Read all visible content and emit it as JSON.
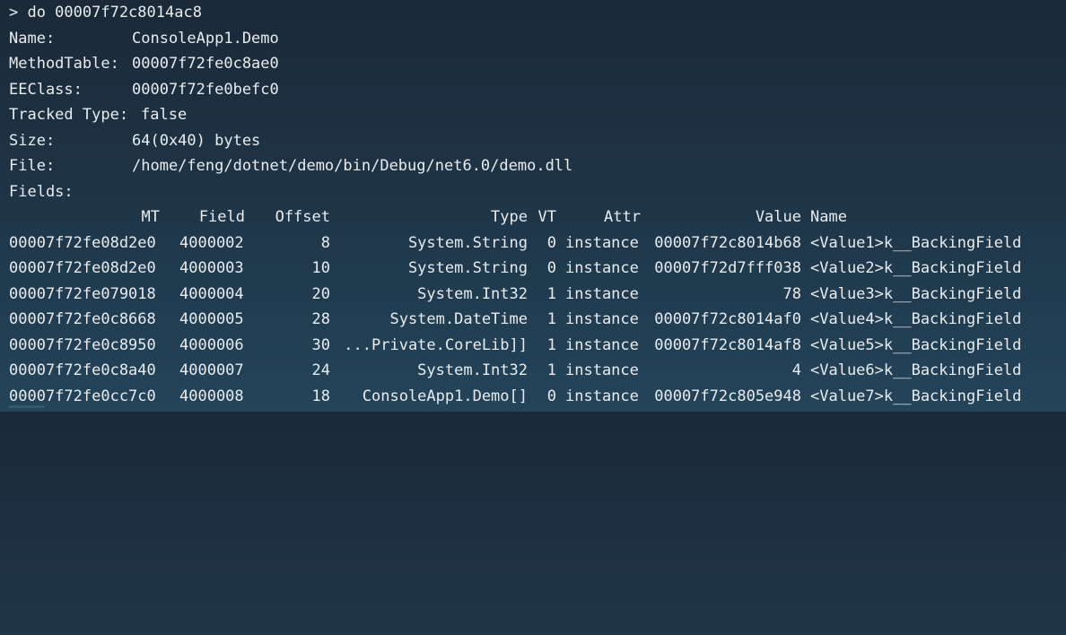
{
  "command": "> do 00007f72c8014ac8",
  "info": [
    {
      "label": "Name:",
      "value": "ConsoleApp1.Demo"
    },
    {
      "label": "MethodTable:",
      "value": "00007f72fe0c8ae0"
    },
    {
      "label": "EEClass:",
      "value": "00007f72fe0befc0"
    },
    {
      "label": "Tracked Type:",
      "value": "false"
    },
    {
      "label": "Size:",
      "value": "64(0x40) bytes"
    },
    {
      "label": "File:",
      "value": "/home/feng/dotnet/demo/bin/Debug/net6.0/demo.dll"
    }
  ],
  "fields_label": "Fields:",
  "table": {
    "headers": {
      "mt": "MT",
      "field": "Field",
      "offset": "Offset",
      "type": "Type",
      "vt": "VT",
      "attr": "Attr",
      "value": "Value",
      "name": "Name"
    },
    "rows": [
      {
        "mt": "00007f72fe08d2e0",
        "field": "4000002",
        "offset": "8",
        "type": "System.String",
        "vt": "0",
        "attr": "instance",
        "value": "00007f72c8014b68",
        "name": "<Value1>k__BackingField"
      },
      {
        "mt": "00007f72fe08d2e0",
        "field": "4000003",
        "offset": "10",
        "type": "System.String",
        "vt": "0",
        "attr": "instance",
        "value": "00007f72d7fff038",
        "name": "<Value2>k__BackingField"
      },
      {
        "mt": "00007f72fe079018",
        "field": "4000004",
        "offset": "20",
        "type": "System.Int32",
        "vt": "1",
        "attr": "instance",
        "value": "78",
        "name": "<Value3>k__BackingField"
      },
      {
        "mt": "00007f72fe0c8668",
        "field": "4000005",
        "offset": "28",
        "type": "System.DateTime",
        "vt": "1",
        "attr": "instance",
        "value": "00007f72c8014af0",
        "name": "<Value4>k__BackingField"
      },
      {
        "mt": "00007f72fe0c8950",
        "field": "4000006",
        "offset": "30",
        "type": "...Private.CoreLib]]",
        "vt": "1",
        "attr": "instance",
        "value": "00007f72c8014af8",
        "name": "<Value5>k__BackingField"
      },
      {
        "mt": "00007f72fe0c8a40",
        "field": "4000007",
        "offset": "24",
        "type": "System.Int32",
        "vt": "1",
        "attr": "instance",
        "value": "4",
        "name": "<Value6>k__BackingField"
      },
      {
        "mt": "00007f72fe0cc7c0",
        "field": "4000008",
        "offset": "18",
        "type": "ConsoleApp1.Demo[]",
        "vt": "0",
        "attr": "instance",
        "value": "00007f72c805e948",
        "name": "<Value7>k__BackingField"
      }
    ]
  }
}
